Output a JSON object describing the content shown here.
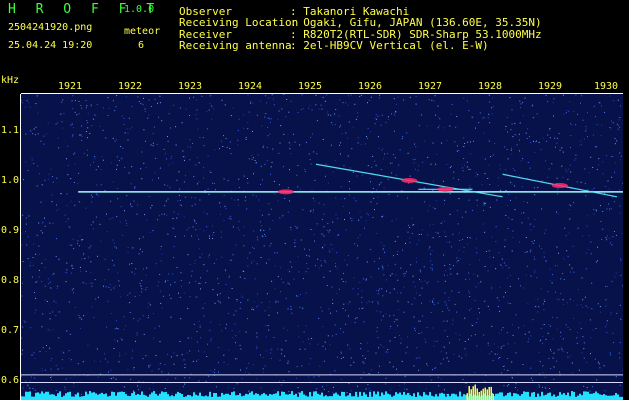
{
  "app": {
    "title": "H R O F F T",
    "version": "1.0.0"
  },
  "file": {
    "name": "2504241920.png",
    "datetime": "25.04.24 19:20"
  },
  "meteor": {
    "label": "meteor",
    "count": "6"
  },
  "info": {
    "rows": [
      {
        "label": "Observer",
        "value": ": Takanori Kawachi"
      },
      {
        "label": "Receiving Location",
        "value": ": Ogaki, Gifu, JAPAN (136.60E, 35.35N)"
      },
      {
        "label": "Receiver",
        "value": ": R820T2(RTL-SDR) SDR-Sharp 53.1000MHz"
      },
      {
        "label": "Receiving antenna",
        "value": ": 2el-HB9CV Vertical (el. E-W)"
      }
    ]
  },
  "colors": {
    "label_yellow": "#ffff4a",
    "title_green": "#3cff3c",
    "background_blue": "#08124a",
    "noise_speck": "#3a6cff",
    "carrier_line": "#9fffff",
    "meteor_hot": "#ff2a6a",
    "baseline_cyan": "#22e0ff"
  },
  "chart_data": {
    "type": "heatmap",
    "xlabel": "",
    "ylabel": "kHz",
    "x_ticks": [
      "1921",
      "1922",
      "1923",
      "1924",
      "1925",
      "1926",
      "1927",
      "1928",
      "1929",
      "1930"
    ],
    "y_ticks": [
      "1.1",
      "1.0",
      "0.9",
      "0.8",
      "0.7",
      "0.6"
    ],
    "xlim": [
      1920,
      1930
    ],
    "ylim": [
      0.57,
      1.18
    ],
    "carrier_khz": 0.985,
    "reference_lines_khz": [
      0.62,
      0.605
    ],
    "meteor_echoes": [
      {
        "x_start": 1924.2,
        "x_end": 1924.6,
        "khz": 0.985
      },
      {
        "x_start": 1924.9,
        "x_end": 1928.0,
        "khz_start": 1.04,
        "khz_end": 0.975
      },
      {
        "x_start": 1926.6,
        "x_end": 1927.5,
        "khz": 0.99
      },
      {
        "x_start": 1928.0,
        "x_end": 1929.9,
        "khz_start": 1.02,
        "khz_end": 0.975
      }
    ]
  }
}
